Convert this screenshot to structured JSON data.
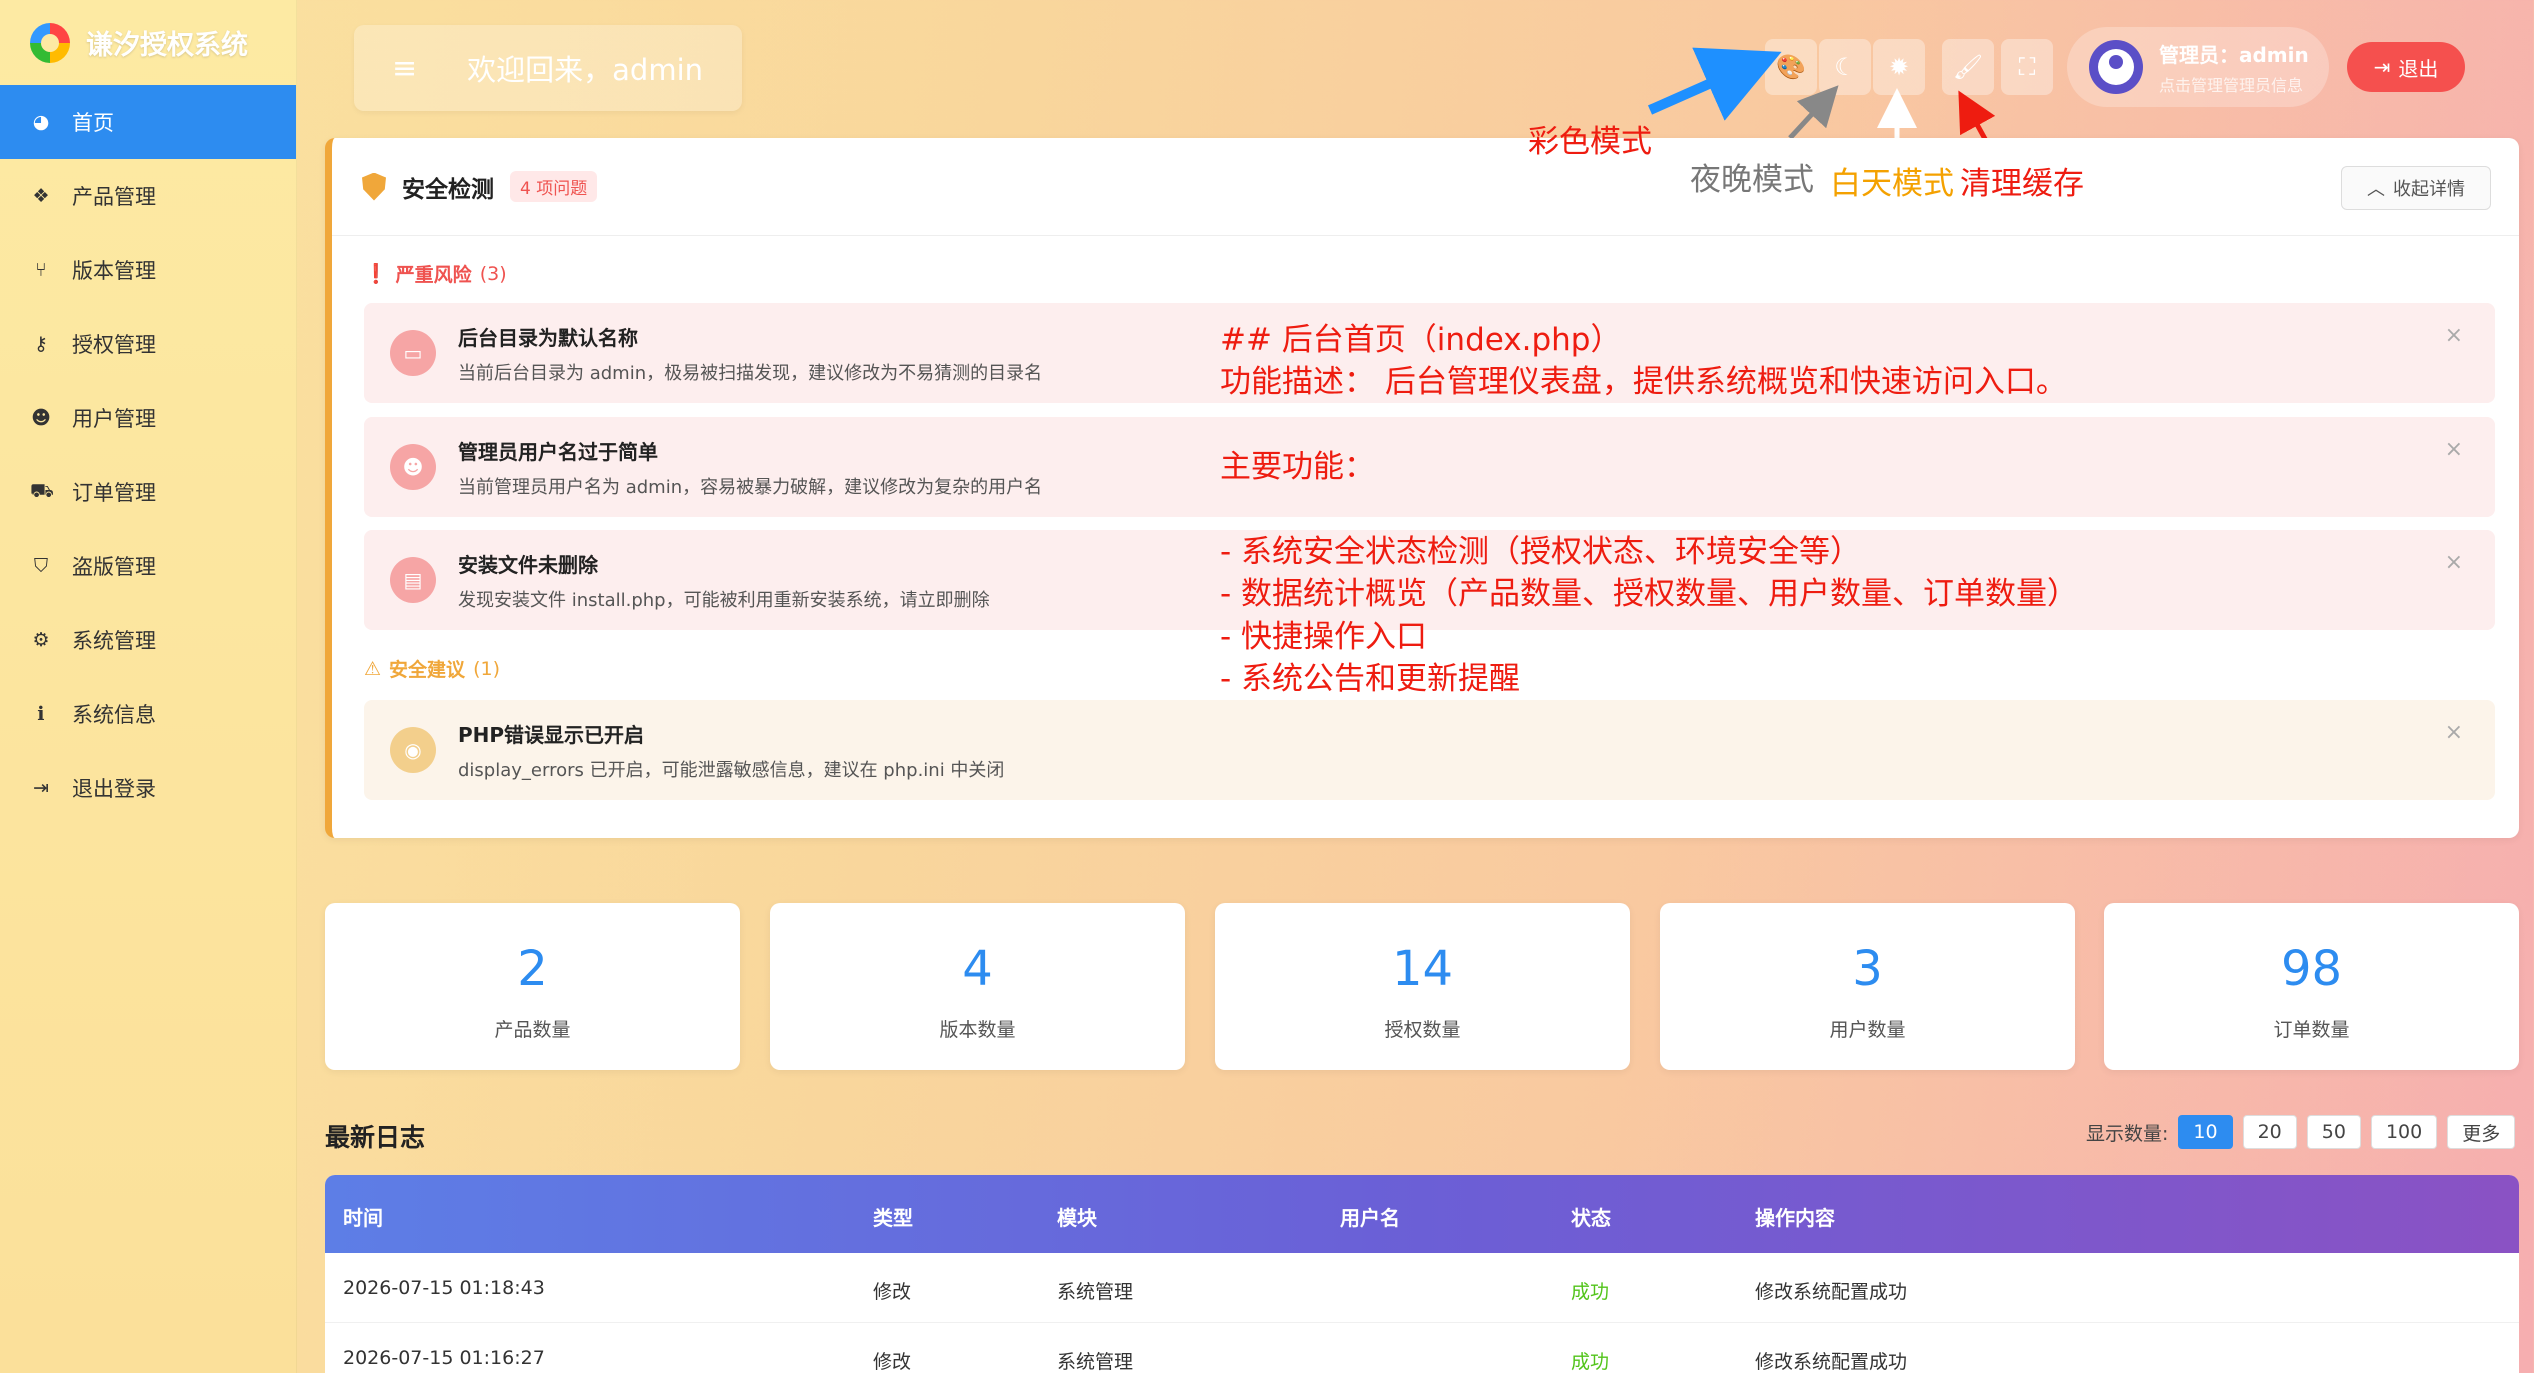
{
  "app": {
    "title": "谦汐授权系统"
  },
  "sidebar": {
    "items": [
      {
        "label": "首页",
        "icon": "dashboard-icon"
      },
      {
        "label": "产品管理",
        "icon": "cubes-icon"
      },
      {
        "label": "版本管理",
        "icon": "code-branch-icon"
      },
      {
        "label": "授权管理",
        "icon": "key-icon"
      },
      {
        "label": "用户管理",
        "icon": "users-icon"
      },
      {
        "label": "订单管理",
        "icon": "cart-icon"
      },
      {
        "label": "盗版管理",
        "icon": "shield-icon"
      },
      {
        "label": "系统管理",
        "icon": "gear-icon"
      },
      {
        "label": "系统信息",
        "icon": "info-icon"
      },
      {
        "label": "退出登录",
        "icon": "sign-out-icon"
      }
    ]
  },
  "header": {
    "welcome": "欢迎回来，admin",
    "admin_name": "管理员：admin",
    "admin_sub": "点击管理管理员信息",
    "logout": "退出"
  },
  "annotations": {
    "color_mode": "彩色模式",
    "night_mode": "夜晚模式",
    "day_mode": "白天模式",
    "clear_cache": "清理缓存",
    "doc_lines": [
      "## 后台首页（index.php）",
      "功能描述： 后台管理仪表盘，提供系统概览和快速访问入口。",
      "主要功能：",
      "- 系统安全状态检测（授权状态、环境安全等）",
      "- 数据统计概览（产品数量、授权数量、用户数量、订单数量）",
      "- 快捷操作入口",
      "- 系统公告和更新提醒"
    ]
  },
  "security": {
    "title": "安全检测",
    "badge": "4 项问题",
    "collapse": "收起详情",
    "severe_label": "严重风险",
    "severe_count": "(3)",
    "suggest_label": "安全建议",
    "suggest_count": "(1)",
    "severe_items": [
      {
        "title": "后台目录为默认名称",
        "desc": "当前后台目录为 admin，极易被扫描发现，建议修改为不易猜测的目录名"
      },
      {
        "title": "管理员用户名过于简单",
        "desc": "当前管理员用户名为 admin，容易被暴力破解，建议修改为复杂的用户名"
      },
      {
        "title": "安装文件未删除",
        "desc": "发现安装文件 install.php，可能被利用重新安装系统，请立即删除"
      }
    ],
    "suggest_items": [
      {
        "title": "PHP错误显示已开启",
        "desc": "display_errors 已开启，可能泄露敏感信息，建议在 php.ini 中关闭"
      }
    ]
  },
  "stats": [
    {
      "value": "2",
      "label": "产品数量"
    },
    {
      "value": "4",
      "label": "版本数量"
    },
    {
      "value": "14",
      "label": "授权数量"
    },
    {
      "value": "3",
      "label": "用户数量"
    },
    {
      "value": "98",
      "label": "订单数量"
    }
  ],
  "logs": {
    "title": "最新日志",
    "page_size_label": "显示数量:",
    "page_sizes": [
      "10",
      "20",
      "50",
      "100",
      "更多"
    ],
    "columns": [
      "时间",
      "类型",
      "模块",
      "用户名",
      "状态",
      "操作内容"
    ],
    "rows": [
      [
        "2026-07-15 01:18:43",
        "修改",
        "系统管理",
        "",
        "成功",
        "修改系统配置成功"
      ],
      [
        "2026-07-15 01:16:27",
        "修改",
        "系统管理",
        "",
        "成功",
        "修改系统配置成功"
      ]
    ]
  },
  "colors": {
    "accent": "#2d8cf0",
    "danger": "#f5504e",
    "warning": "#f0a73a",
    "annotation_red": "#ee1c10"
  }
}
